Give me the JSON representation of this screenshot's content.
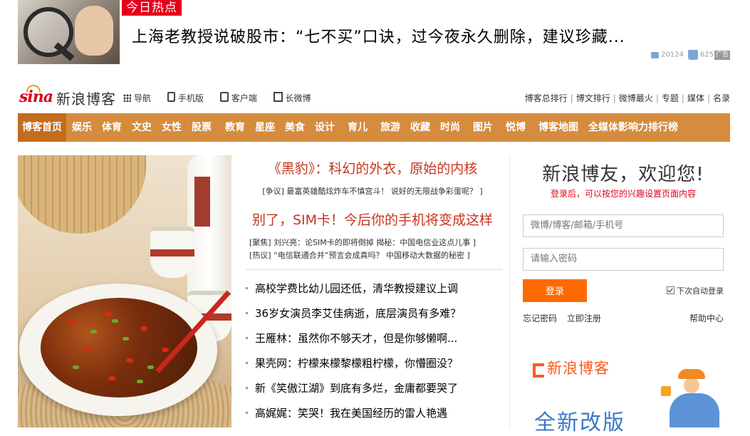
{
  "hot_ad": {
    "badge": "今日热点",
    "title": "上海老教授说破股市：“七不买”口诀，过今夜永久删除，建议珍藏...",
    "comments": "20124",
    "likes": "625",
    "ad_label": "广告"
  },
  "header": {
    "logo_brand": "sina",
    "logo_text": "新浪博客",
    "top_links": [
      "导航",
      "手机版",
      "客户端",
      "长微博"
    ],
    "right_links": [
      "博客总排行",
      "博文排行",
      "微博最火",
      "专题",
      "媒体",
      "名录"
    ]
  },
  "channels": [
    "博客首页",
    "娱乐",
    "体育",
    "文史",
    "女性",
    "股票",
    "教育",
    "星座",
    "美食",
    "设计",
    "育儿",
    "旅游",
    "收藏",
    "时尚",
    "图片",
    "悦博",
    "博客地图",
    "全媒体影响力排行榜"
  ],
  "news": {
    "headline1": "《黑豹》：科幻的外衣，原始的内核",
    "headline1_sub": "[争议] 最富英雄酷炫炸车不慎宫斗！ 说好的无限战争彩蛋呢？ ]",
    "headline2": "别了，SIM卡！今后你的手机将变成这样",
    "headline2_sub1": "[聚焦] 刘兴亮：论SIM卡的即将倒掉 揭秘：中国电信业这点儿事 ]",
    "headline2_sub2": "[热议] “电信联通合并”预言会成真吗？ 中国移动大数据的秘密 ]",
    "items": [
      "高校学费比幼儿园还低，清华教授建议上调",
      "36岁女演员李艾佳病逝，底层演员有多难？",
      "王雁林：虽然你不够天才，但是你够懒啊...",
      "果壳网：柠檬来檬黎檬粗柠檬，你懵圈没？",
      "新《笑傲江湖》到底有多烂，金庸都要哭了",
      "高娓娓：笑哭！我在美国经历的雷人艳遇"
    ]
  },
  "login": {
    "welcome": "新浪博友，欢迎您!",
    "subtitle": "登录后，可以按您的兴趣设置页面内容",
    "username_placeholder": "微博/博客/邮箱/手机号",
    "password_placeholder": "请输入密码",
    "login_button": "登录",
    "auto_login": "下次自动登录",
    "forgot_password": "忘记密码",
    "register": "立即注册",
    "help": "帮助中心"
  },
  "promo": {
    "brand": "新浪博客",
    "tagline": "全新改版"
  },
  "colors": {
    "channel_bar": "#d58c3e",
    "channel_active": "#c46c1e",
    "headline_red": "#c7341f",
    "login_button": "#ff6a00",
    "hot_badge": "#e4001b"
  },
  "icons": [
    "comment-icon",
    "like-icon",
    "grid-icon",
    "phone-icon",
    "client-icon",
    "doc-icon",
    "checkbox-icon",
    "promo-logo-icon"
  ]
}
